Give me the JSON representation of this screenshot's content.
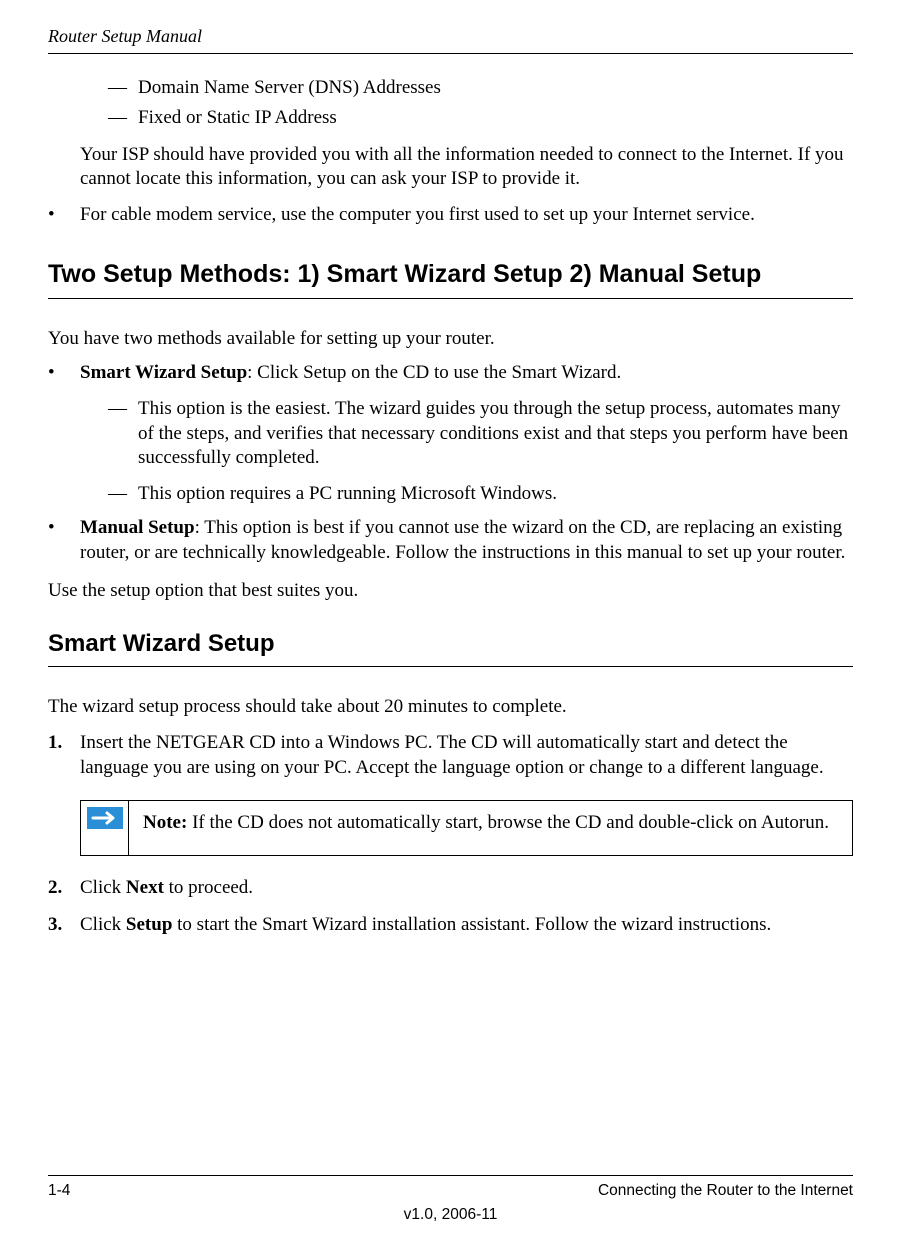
{
  "header": {
    "title": "Router Setup Manual"
  },
  "top_dashes": {
    "d1": "Domain Name Server (DNS) Addresses",
    "d2": "Fixed or Static IP Address"
  },
  "isp_para": "Your ISP should have provided you with all the information needed to connect to the Internet. If you cannot locate this information, you can ask your ISP to provide it.",
  "cable_bullet": "For cable modem service, use the computer you first used to set up your Internet service.",
  "h1a": "Two Setup Methods: 1) Smart Wizard Setup 2) Manual Setup",
  "two_methods_intro": "You have two methods available for setting up your router.",
  "sw_label": "Smart Wizard Setup",
  "sw_rest": ": Click Setup on the CD to use the Smart Wizard.",
  "sw_d1": "This option is the easiest. The wizard guides you through the setup process, automates many of the steps, and verifies that necessary conditions exist and that steps you perform have been successfully completed.",
  "sw_d2": "This option requires a PC running Microsoft Windows.",
  "ms_label": "Manual Setup",
  "ms_rest": ": This option is best if you cannot use the wizard on the CD, are replacing an existing router, or are technically knowledgeable. Follow the instructions in this manual to set up your router.",
  "use_option": "Use the setup option that best suites you.",
  "h2a": "Smart Wizard Setup",
  "wiz_time": "The wizard setup process should take about 20 minutes to complete.",
  "step1_num": "1.",
  "step1_text": "Insert the NETGEAR CD into a Windows PC. The CD will automatically start and detect the language you are using on your PC. Accept the language option or change to a different language.",
  "note_label": "Note:",
  "note_text": " If the CD does not automatically start, browse the CD and double-click on Autorun.",
  "step2_num": "2.",
  "step2_a": "Click ",
  "step2_bold": "Next",
  "step2_b": " to proceed.",
  "step3_num": "3.",
  "step3_a": "Click ",
  "step3_bold": "Setup",
  "step3_b": " to start the Smart Wizard installation assistant. Follow the wizard instructions.",
  "footer": {
    "left": "1-4",
    "right": "Connecting the Router to the Internet",
    "center": "v1.0, 2006-11"
  }
}
